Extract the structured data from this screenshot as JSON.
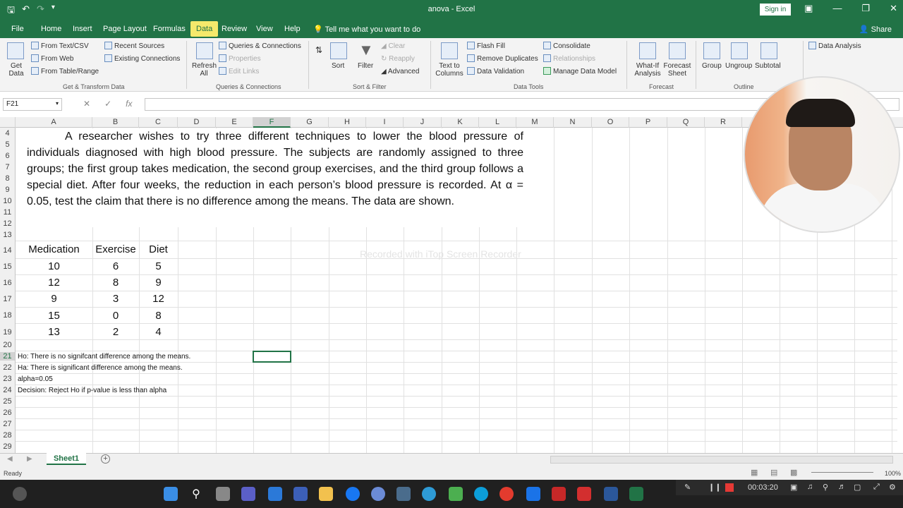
{
  "window": {
    "title": "anova - Excel",
    "sign_in": "Sign in"
  },
  "tabs": [
    "File",
    "Home",
    "Insert",
    "Page Layout",
    "Formulas",
    "Data",
    "Review",
    "View",
    "Help"
  ],
  "active_tab": "Data",
  "tell_me": "Tell me what you want to do",
  "share": "Share",
  "ribbon": {
    "get_data": "Get Data",
    "from_text_csv": "From Text/CSV",
    "from_web": "From Web",
    "from_table_range": "From Table/Range",
    "recent_sources": "Recent Sources",
    "existing_connections": "Existing Connections",
    "group_get_transform": "Get & Transform Data",
    "refresh_all": "Refresh All",
    "queries_connections": "Queries & Connections",
    "properties": "Properties",
    "edit_links": "Edit Links",
    "group_queries": "Queries & Connections",
    "sort": "Sort",
    "filter": "Filter",
    "clear": "Clear",
    "reapply": "Reapply",
    "advanced": "Advanced",
    "group_sort_filter": "Sort & Filter",
    "text_to_columns": "Text to Columns",
    "flash_fill": "Flash Fill",
    "remove_duplicates": "Remove Duplicates",
    "data_validation": "Data Validation",
    "consolidate": "Consolidate",
    "relationships": "Relationships",
    "manage_data_model": "Manage Data Model",
    "group_data_tools": "Data Tools",
    "what_if": "What-If Analysis",
    "forecast_sheet": "Forecast Sheet",
    "group_forecast": "Forecast",
    "group": "Group",
    "ungroup": "Ungroup",
    "subtotal": "Subtotal",
    "group_outline": "Outline",
    "data_analysis": "Data Analysis"
  },
  "formula_bar": {
    "name_box": "F21",
    "fx": "fx",
    "value": ""
  },
  "columns": [
    "A",
    "B",
    "C",
    "D",
    "E",
    "F",
    "G",
    "H",
    "I",
    "J",
    "K",
    "L",
    "M",
    "N",
    "O",
    "P",
    "Q",
    "R"
  ],
  "rows": [
    "4",
    "5",
    "6",
    "7",
    "8",
    "9",
    "10",
    "11",
    "12",
    "13",
    "14",
    "15",
    "16",
    "17",
    "18",
    "19",
    "20",
    "21",
    "22",
    "23",
    "24",
    "25",
    "26",
    "27",
    "28",
    "29"
  ],
  "problem_text": "A researcher wishes to try three different techniques to lower the blood pressure of individuals diagnosed with high blood pressure. The subjects are randomly assigned to three groups; the first group takes medication, the second group exercises, and the third group follows a special diet. After four weeks, the reduction in each person’s blood pressure is recorded. At α = 0.05, test the claim that there is no difference among the means. The data are shown.",
  "table": {
    "headers": [
      "Medication",
      "Exercise",
      "Diet"
    ],
    "rows": [
      [
        "10",
        "6",
        "5"
      ],
      [
        "12",
        "8",
        "9"
      ],
      [
        "9",
        "3",
        "12"
      ],
      [
        "15",
        "0",
        "8"
      ],
      [
        "13",
        "2",
        "4"
      ]
    ]
  },
  "notes": [
    "Ho: There is no signifcant difference among the means.",
    "Ha: There is significant difference among the means.",
    "alpha=0.05",
    "Decision: Reject Ho if p-value is less than alpha"
  ],
  "watermark": "Recorded with iTop Screen Recorder",
  "sheet_tab": "Sheet1",
  "status": "Ready",
  "zoom": "100%",
  "recorder_time": "00:03:20"
}
